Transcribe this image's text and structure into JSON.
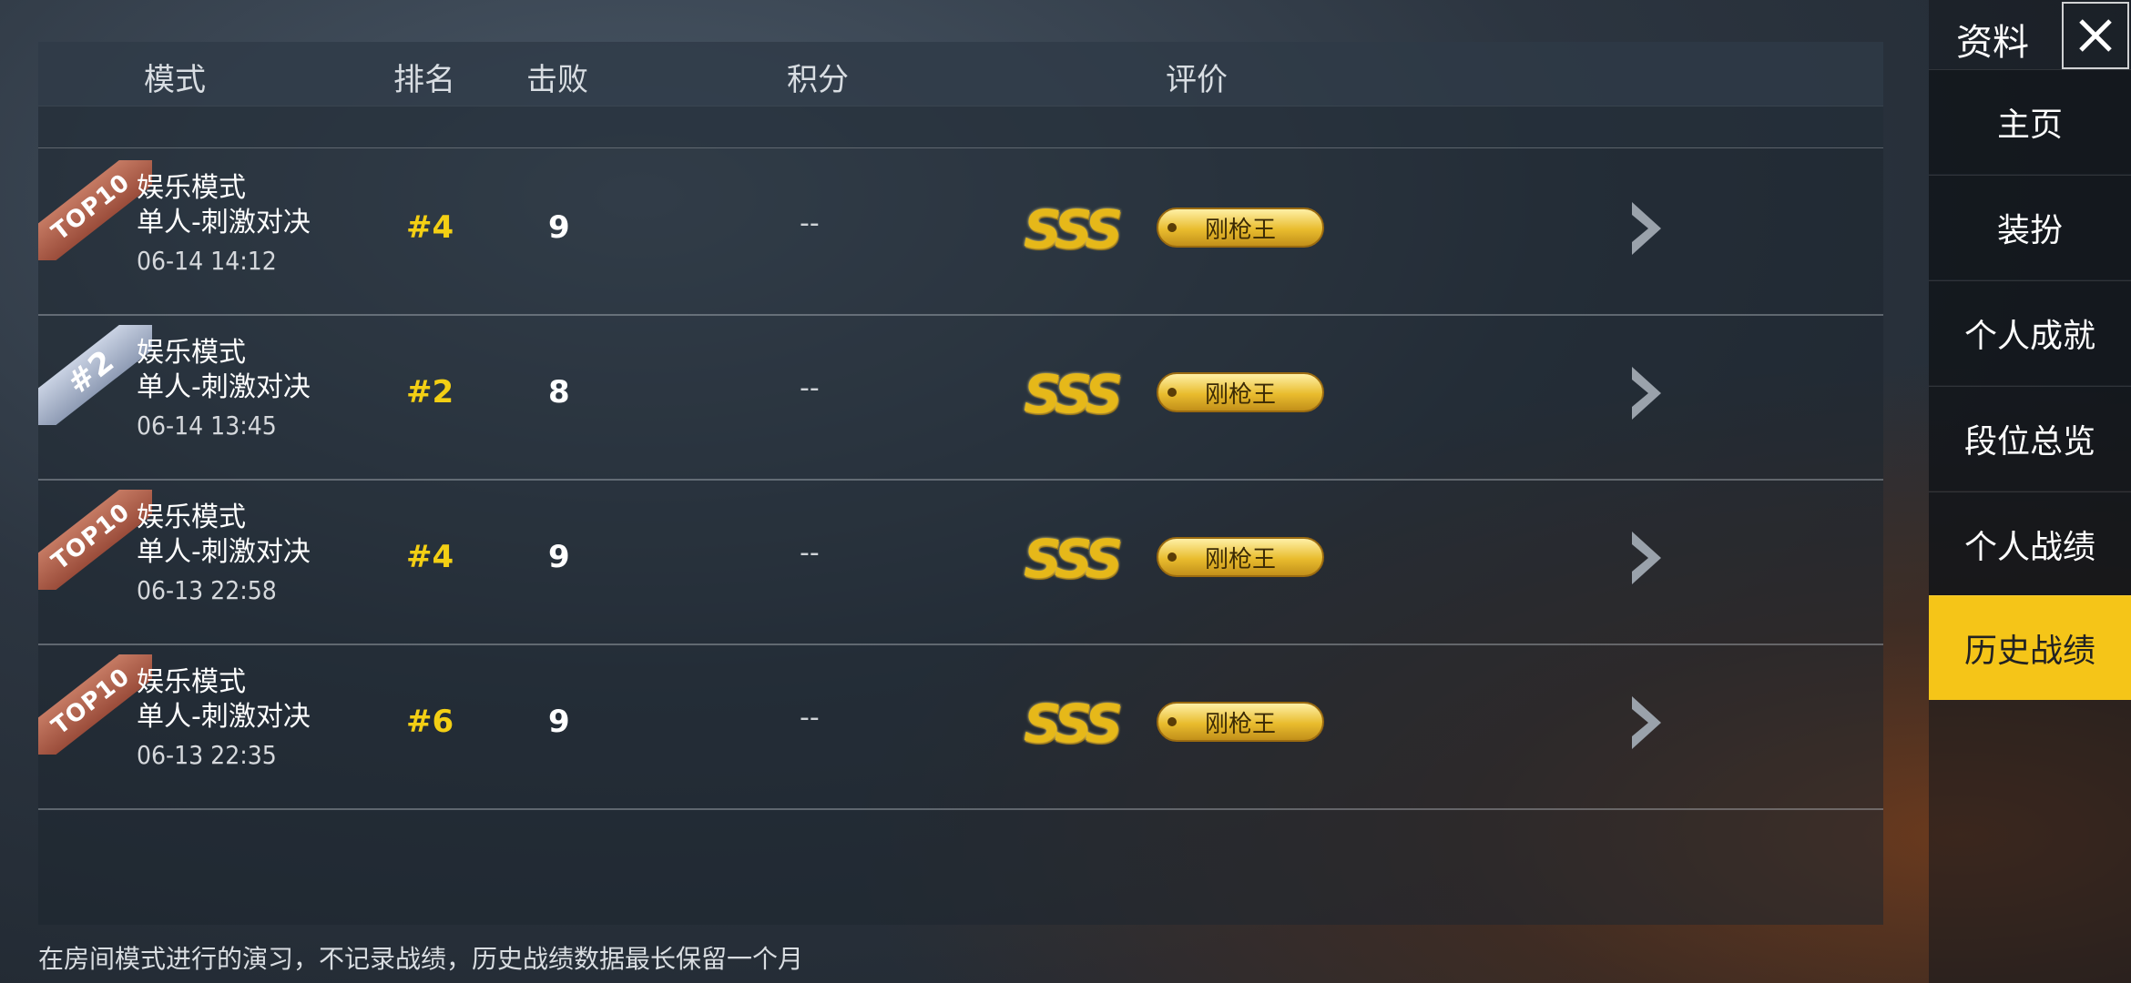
{
  "table": {
    "headers": {
      "mode": "模式",
      "rank": "排名",
      "kills": "击败",
      "score": "积分",
      "rating": "评价"
    },
    "rows": [
      {
        "ribbon": "TOP10",
        "mode_line1": "娱乐模式",
        "mode_line2": "单人-刺激对决",
        "date": "06-14 14:12",
        "rank": "#4",
        "kills": "9",
        "score": "--",
        "grade": "SSS",
        "title_badge": "刚枪王"
      },
      {
        "ribbon": "#2",
        "mode_line1": "娱乐模式",
        "mode_line2": "单人-刺激对决",
        "date": "06-14 13:45",
        "rank": "#2",
        "kills": "8",
        "score": "--",
        "grade": "SSS",
        "title_badge": "刚枪王"
      },
      {
        "ribbon": "TOP10",
        "mode_line1": "娱乐模式",
        "mode_line2": "单人-刺激对决",
        "date": "06-13 22:58",
        "rank": "#4",
        "kills": "9",
        "score": "--",
        "grade": "SSS",
        "title_badge": "刚枪王"
      },
      {
        "ribbon": "TOP10",
        "mode_line1": "娱乐模式",
        "mode_line2": "单人-刺激对决",
        "date": "06-13 22:35",
        "rank": "#6",
        "kills": "9",
        "score": "--",
        "grade": "SSS",
        "title_badge": "刚枪王"
      }
    ]
  },
  "footer_note": "在房间模式进行的演习，不记录战绩，历史战绩数据最长保留一个月",
  "sidebar": {
    "title": "资料",
    "items": [
      {
        "label": "主页"
      },
      {
        "label": "装扮"
      },
      {
        "label": "个人成就"
      },
      {
        "label": "段位总览"
      },
      {
        "label": "个人战绩"
      },
      {
        "label": "历史战绩",
        "active": true
      }
    ]
  },
  "colors": {
    "accent": "#f5c518",
    "rank_text": "#f3cf14",
    "badge_gold": "#e9bc2e"
  },
  "icons": {
    "close": "close-icon",
    "row_arrow": "chevron-right-icon"
  }
}
